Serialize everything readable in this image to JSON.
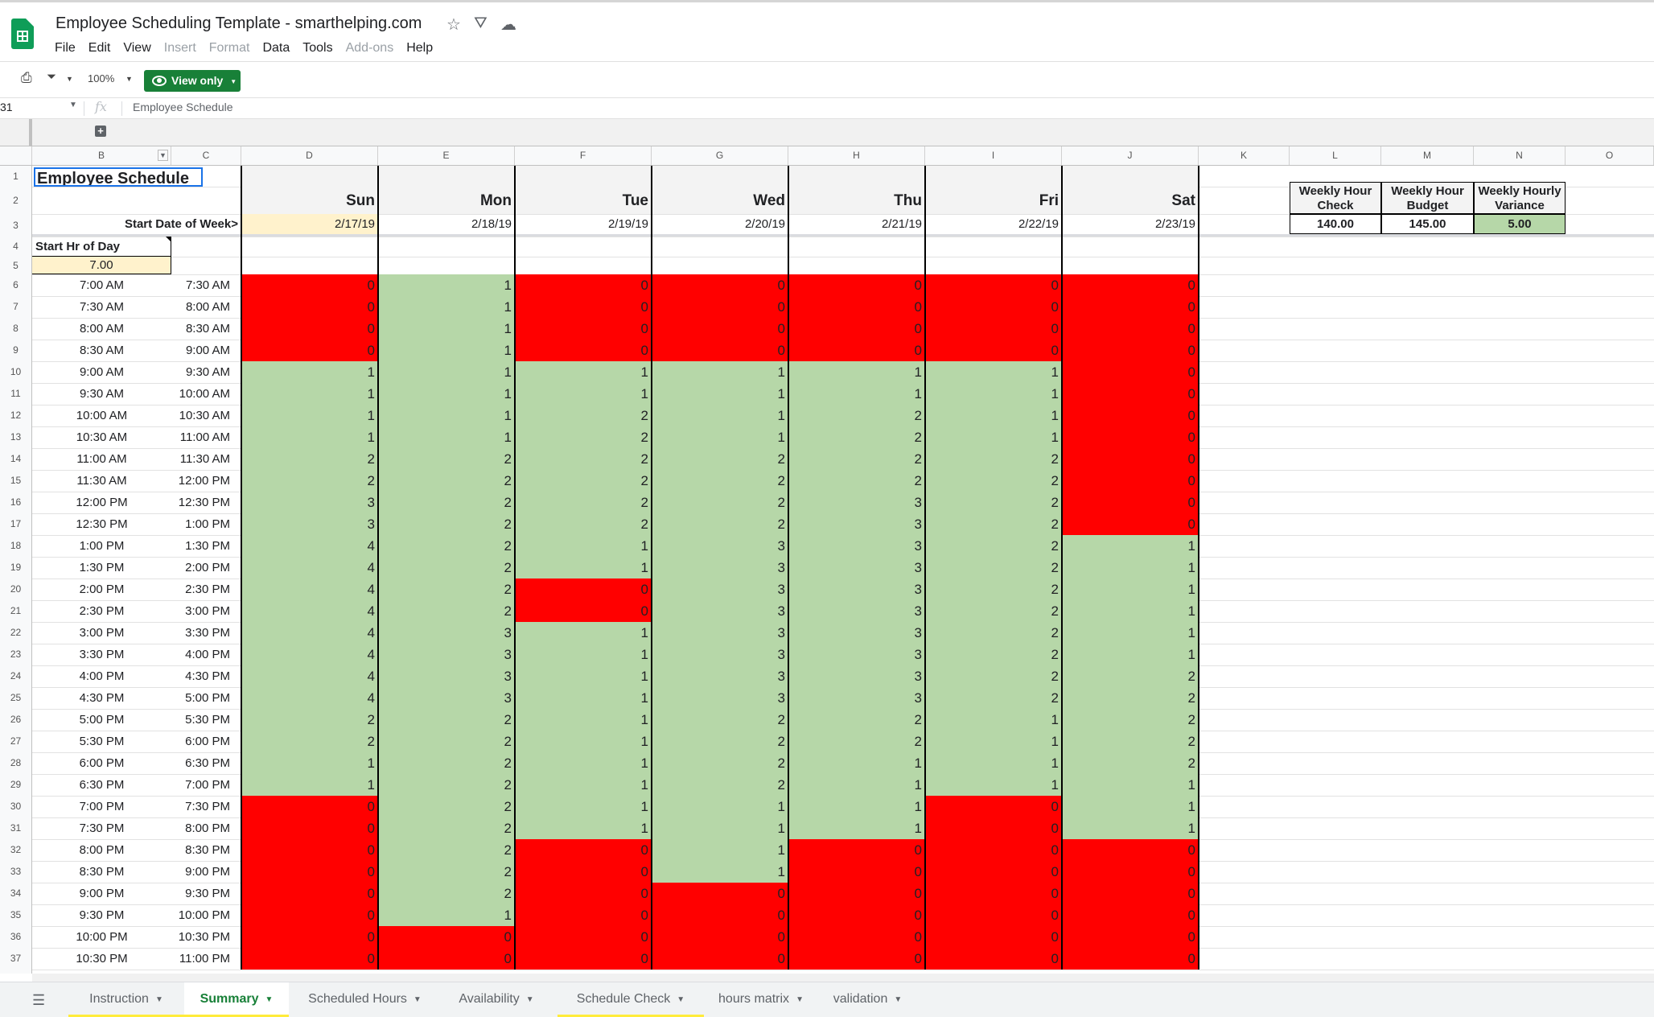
{
  "app": {
    "doc_title": "Employee Scheduling Template - smarthelping.com",
    "menu": [
      {
        "label": "File",
        "disabled": false
      },
      {
        "label": "Edit",
        "disabled": false
      },
      {
        "label": "View",
        "disabled": false
      },
      {
        "label": "Insert",
        "disabled": true
      },
      {
        "label": "Format",
        "disabled": true
      },
      {
        "label": "Data",
        "disabled": false
      },
      {
        "label": "Tools",
        "disabled": false
      },
      {
        "label": "Add-ons",
        "disabled": true
      },
      {
        "label": "Help",
        "disabled": false
      }
    ],
    "zoom": "100%",
    "view_only_label": "View only",
    "accent_color": "#188038"
  },
  "formula_bar": {
    "name_box": "31",
    "fx_label": "fx",
    "content": "Employee Schedule"
  },
  "columns": [
    "B",
    "C",
    "D",
    "E",
    "F",
    "G",
    "H",
    "I",
    "J",
    "K",
    "L",
    "M",
    "N",
    "O"
  ],
  "sheet": {
    "title": "Employee Schedule",
    "days": [
      "Sun",
      "Mon",
      "Tue",
      "Wed",
      "Thu",
      "Fri",
      "Sat"
    ],
    "start_date_label": "Start Date of Week>",
    "dates": [
      "2/17/19",
      "2/18/19",
      "2/19/19",
      "2/20/19",
      "2/21/19",
      "2/22/19",
      "2/23/19"
    ],
    "start_hr_label": "Start Hr of Day",
    "start_hr_value": "7.00",
    "summary": {
      "headers": [
        "Weekly Hour Check",
        "Weekly Hour Budget",
        "Weekly Hourly Variance"
      ],
      "values": [
        "140.00",
        "145.00",
        "5.00"
      ]
    },
    "colors": {
      "understaffed": "#ff0000",
      "staffed": "#b6d7a8",
      "input_yellow": "#fff2cc"
    },
    "rows": [
      {
        "row": "6",
        "start": "7:00 AM",
        "end": "7:30 AM",
        "counts": [
          "0",
          "1",
          "0",
          "0",
          "0",
          "0",
          "0"
        ]
      },
      {
        "row": "7",
        "start": "7:30 AM",
        "end": "8:00 AM",
        "counts": [
          "0",
          "1",
          "0",
          "0",
          "0",
          "0",
          "0"
        ]
      },
      {
        "row": "8",
        "start": "8:00 AM",
        "end": "8:30 AM",
        "counts": [
          "0",
          "1",
          "0",
          "0",
          "0",
          "0",
          "0"
        ]
      },
      {
        "row": "9",
        "start": "8:30 AM",
        "end": "9:00 AM",
        "counts": [
          "0",
          "1",
          "0",
          "0",
          "0",
          "0",
          "0"
        ]
      },
      {
        "row": "10",
        "start": "9:00 AM",
        "end": "9:30 AM",
        "counts": [
          "1",
          "1",
          "1",
          "1",
          "1",
          "1",
          "0"
        ]
      },
      {
        "row": "11",
        "start": "9:30 AM",
        "end": "10:00 AM",
        "counts": [
          "1",
          "1",
          "1",
          "1",
          "1",
          "1",
          "0"
        ]
      },
      {
        "row": "12",
        "start": "10:00 AM",
        "end": "10:30 AM",
        "counts": [
          "1",
          "1",
          "2",
          "1",
          "2",
          "1",
          "0"
        ]
      },
      {
        "row": "13",
        "start": "10:30 AM",
        "end": "11:00 AM",
        "counts": [
          "1",
          "1",
          "2",
          "1",
          "2",
          "1",
          "0"
        ]
      },
      {
        "row": "14",
        "start": "11:00 AM",
        "end": "11:30 AM",
        "counts": [
          "2",
          "2",
          "2",
          "2",
          "2",
          "2",
          "0"
        ]
      },
      {
        "row": "15",
        "start": "11:30 AM",
        "end": "12:00 PM",
        "counts": [
          "2",
          "2",
          "2",
          "2",
          "2",
          "2",
          "0"
        ]
      },
      {
        "row": "16",
        "start": "12:00 PM",
        "end": "12:30 PM",
        "counts": [
          "3",
          "2",
          "2",
          "2",
          "3",
          "2",
          "0"
        ]
      },
      {
        "row": "17",
        "start": "12:30 PM",
        "end": "1:00 PM",
        "counts": [
          "3",
          "2",
          "2",
          "2",
          "3",
          "2",
          "0"
        ]
      },
      {
        "row": "18",
        "start": "1:00 PM",
        "end": "1:30 PM",
        "counts": [
          "4",
          "2",
          "1",
          "3",
          "3",
          "2",
          "1"
        ]
      },
      {
        "row": "19",
        "start": "1:30 PM",
        "end": "2:00 PM",
        "counts": [
          "4",
          "2",
          "1",
          "3",
          "3",
          "2",
          "1"
        ]
      },
      {
        "row": "20",
        "start": "2:00 PM",
        "end": "2:30 PM",
        "counts": [
          "4",
          "2",
          "0",
          "3",
          "3",
          "2",
          "1"
        ]
      },
      {
        "row": "21",
        "start": "2:30 PM",
        "end": "3:00 PM",
        "counts": [
          "4",
          "2",
          "0",
          "3",
          "3",
          "2",
          "1"
        ]
      },
      {
        "row": "22",
        "start": "3:00 PM",
        "end": "3:30 PM",
        "counts": [
          "4",
          "3",
          "1",
          "3",
          "3",
          "2",
          "1"
        ]
      },
      {
        "row": "23",
        "start": "3:30 PM",
        "end": "4:00 PM",
        "counts": [
          "4",
          "3",
          "1",
          "3",
          "3",
          "2",
          "1"
        ]
      },
      {
        "row": "24",
        "start": "4:00 PM",
        "end": "4:30 PM",
        "counts": [
          "4",
          "3",
          "1",
          "3",
          "3",
          "2",
          "2"
        ]
      },
      {
        "row": "25",
        "start": "4:30 PM",
        "end": "5:00 PM",
        "counts": [
          "4",
          "3",
          "1",
          "3",
          "3",
          "2",
          "2"
        ]
      },
      {
        "row": "26",
        "start": "5:00 PM",
        "end": "5:30 PM",
        "counts": [
          "2",
          "2",
          "1",
          "2",
          "2",
          "1",
          "2"
        ]
      },
      {
        "row": "27",
        "start": "5:30 PM",
        "end": "6:00 PM",
        "counts": [
          "2",
          "2",
          "1",
          "2",
          "2",
          "1",
          "2"
        ]
      },
      {
        "row": "28",
        "start": "6:00 PM",
        "end": "6:30 PM",
        "counts": [
          "1",
          "2",
          "1",
          "2",
          "1",
          "1",
          "2"
        ]
      },
      {
        "row": "29",
        "start": "6:30 PM",
        "end": "7:00 PM",
        "counts": [
          "1",
          "2",
          "1",
          "2",
          "1",
          "1",
          "1"
        ]
      },
      {
        "row": "30",
        "start": "7:00 PM",
        "end": "7:30 PM",
        "counts": [
          "0",
          "2",
          "1",
          "1",
          "1",
          "0",
          "1"
        ]
      },
      {
        "row": "31",
        "start": "7:30 PM",
        "end": "8:00 PM",
        "counts": [
          "0",
          "2",
          "1",
          "1",
          "1",
          "0",
          "1"
        ]
      },
      {
        "row": "32",
        "start": "8:00 PM",
        "end": "8:30 PM",
        "counts": [
          "0",
          "2",
          "0",
          "1",
          "0",
          "0",
          "0"
        ]
      },
      {
        "row": "33",
        "start": "8:30 PM",
        "end": "9:00 PM",
        "counts": [
          "0",
          "2",
          "0",
          "1",
          "0",
          "0",
          "0"
        ]
      },
      {
        "row": "34",
        "start": "9:00 PM",
        "end": "9:30 PM",
        "counts": [
          "0",
          "2",
          "0",
          "0",
          "0",
          "0",
          "0"
        ]
      },
      {
        "row": "35",
        "start": "9:30 PM",
        "end": "10:00 PM",
        "counts": [
          "0",
          "1",
          "0",
          "0",
          "0",
          "0",
          "0"
        ]
      },
      {
        "row": "36",
        "start": "10:00 PM",
        "end": "10:30 PM",
        "counts": [
          "0",
          "0",
          "0",
          "0",
          "0",
          "0",
          "0"
        ]
      },
      {
        "row": "37",
        "start": "10:30 PM",
        "end": "11:00 PM",
        "counts": [
          "0",
          "0",
          "0",
          "0",
          "0",
          "0",
          "0"
        ]
      }
    ]
  },
  "tabs": [
    {
      "label": "Instruction",
      "active": false,
      "yellow": true
    },
    {
      "label": "Summary",
      "active": true,
      "yellow": true
    },
    {
      "label": "Scheduled Hours",
      "active": false,
      "yellow": false
    },
    {
      "label": "Availability",
      "active": false,
      "yellow": false
    },
    {
      "label": "Schedule Check",
      "active": false,
      "yellow": true
    },
    {
      "label": "hours matrix",
      "active": false,
      "yellow": false
    },
    {
      "label": "validation",
      "active": false,
      "yellow": false
    }
  ],
  "icons": [
    "sheets-logo-icon",
    "star-icon",
    "move-to-drive-icon",
    "cloud-status-icon",
    "print-icon",
    "filter-icon",
    "eye-icon",
    "add-group-icon",
    "all-sheets-icon"
  ]
}
